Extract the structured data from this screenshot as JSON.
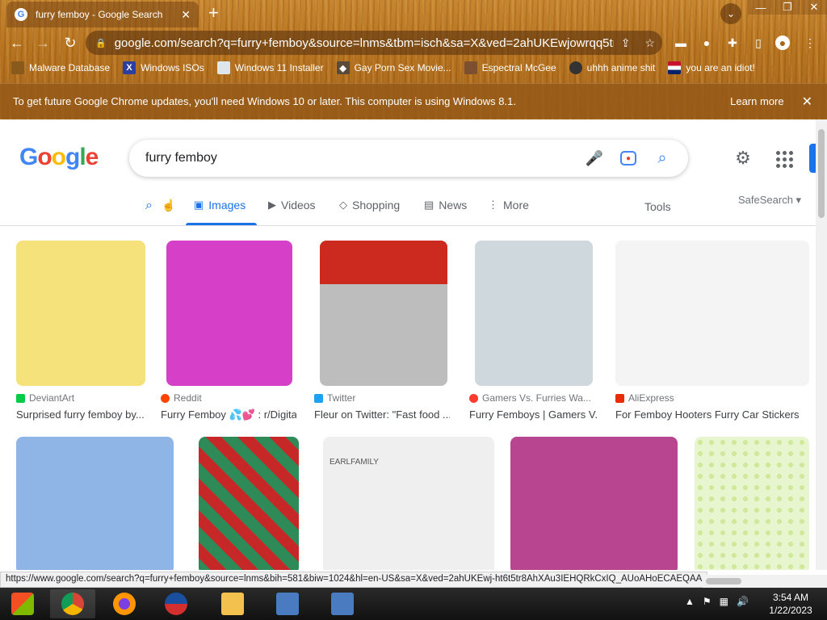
{
  "browser": {
    "tab": {
      "title": "furry femboy - Google Search",
      "close": "✕"
    },
    "new_tab": "+",
    "url": "google.com/search?q=furry+femboy&source=lnms&tbm=isch&sa=X&ved=2ahUKEwjowrqq5tr...",
    "bookmarks": [
      {
        "label": "Malware Database",
        "icon": "malware-icon"
      },
      {
        "label": "Windows ISOs",
        "icon": "x-icon"
      },
      {
        "label": "Windows 11 Installer",
        "icon": "image-icon"
      },
      {
        "label": "Gay Porn Sex Movie...",
        "icon": "bookmark-icon"
      },
      {
        "label": "Espectral McGee",
        "icon": "avatar-icon"
      },
      {
        "label": "uhhh anime shit",
        "icon": "anime-icon"
      },
      {
        "label": "you are an idiot!",
        "icon": "flag-icon"
      }
    ],
    "infobar": {
      "message": "To get future Google Chrome updates, you'll need Windows 10 or later. This computer is using Windows 8.1.",
      "learn_more": "Learn more"
    }
  },
  "search": {
    "query": "furry femboy",
    "tabs": [
      {
        "label": "Images",
        "active": true
      },
      {
        "label": "Videos"
      },
      {
        "label": "Shopping"
      },
      {
        "label": "News"
      },
      {
        "label": "More"
      }
    ],
    "tools": "Tools",
    "safesearch": "SafeSearch"
  },
  "results_row1": [
    {
      "source": "DeviantArt",
      "caption": "Surprised furry femboy by...",
      "fav": "#05cc47",
      "bg": "#f6e27a"
    },
    {
      "source": "Reddit",
      "caption": "Furry Femboy 💦💕 : r/Digita...",
      "fav": "#ff4500",
      "bg": "#d63fc7"
    },
    {
      "source": "Twitter",
      "caption": "Fleur on Twitter: \"Fast food ...",
      "fav": "#1da1f2",
      "bg": "#cc2a1f"
    },
    {
      "source": "Gamers Vs. Furries Wa...",
      "caption": "Furry Femboys | Gamers V...",
      "fav": "#ff3b2f",
      "bg": "#cfd8dc"
    },
    {
      "source": "AliExpress",
      "caption": "For Femboy Hooters Furry Car Stickers ...",
      "fav": "#e62e04",
      "bg": "#f4f4f4"
    }
  ],
  "results_row2": [
    {
      "bg": "#8fb4e6"
    },
    {
      "bg": "#2e8b57"
    },
    {
      "bg": "#efefef",
      "text": "EARLFAMILY"
    },
    {
      "bg": "#b8458f"
    },
    {
      "bg": "#9acd32"
    }
  ],
  "status_url": "https://www.google.com/search?q=furry+femboy&source=lnms&bih=581&biw=1024&hl=en-US&sa=X&ved=2ahUKEwj-ht6t5tr8AhXAu3IEHQRkCxIQ_AUoAHoECAEQAA",
  "clock": {
    "time": "3:54 AM",
    "date": "1/22/2023"
  }
}
